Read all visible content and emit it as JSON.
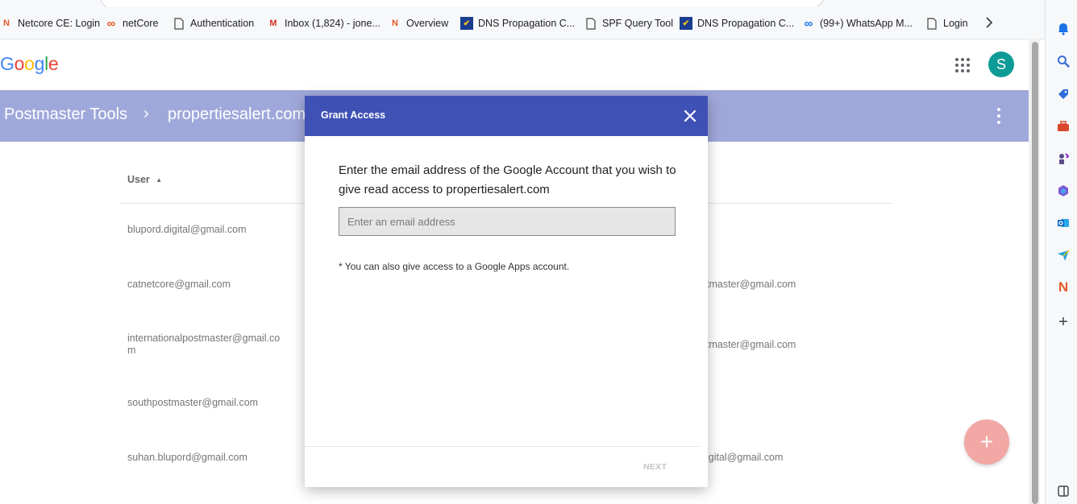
{
  "colors": {
    "header_band": "#9fa8da",
    "dialog_header": "#3f51b5",
    "avatar_bg": "#0e9b96",
    "fab_bg": "#f2a8a4"
  },
  "bookmarks": [
    {
      "label": "Netcore CE: Login",
      "icon": "netcore-n-icon"
    },
    {
      "label": "netCore",
      "icon": "infinity-icon"
    },
    {
      "label": "Authentication",
      "icon": "page-icon"
    },
    {
      "label": "Inbox (1,824) - jone...",
      "icon": "gmail-icon"
    },
    {
      "label": "Overview",
      "icon": "netcore-n-icon"
    },
    {
      "label": "DNS Propagation C...",
      "icon": "dns-check-icon"
    },
    {
      "label": "SPF Query Tool",
      "icon": "page-icon"
    },
    {
      "label": "DNS Propagation C...",
      "icon": "dns-check-icon"
    },
    {
      "label": "(99+) WhatsApp M...",
      "icon": "meta-icon"
    },
    {
      "label": "Login",
      "icon": "page-icon"
    }
  ],
  "google_logo": [
    "G",
    "o",
    "o",
    "g",
    "l",
    "e"
  ],
  "account": {
    "initial": "S"
  },
  "breadcrumb": {
    "root": "Postmaster Tools",
    "separator": "›",
    "domain": "propertiesalert.com"
  },
  "table": {
    "user_header": "User",
    "sort_indicator": "▲",
    "rows": [
      {
        "user": "blupord.digital@gmail.com",
        "right": ""
      },
      {
        "user": "catnetcore@gmail.com",
        "right": "tmaster@gmail.com"
      },
      {
        "user": "internationalpostmaster@gmail.co\nm",
        "right": "tmaster@gmail.com"
      },
      {
        "user": "southpostmaster@gmail.com",
        "right": ""
      },
      {
        "user": "suhan.blupord@gmail.com",
        "right": "igital@gmail.com"
      }
    ]
  },
  "dialog": {
    "title": "Grant Access",
    "message": "Enter the email address of the Google Account that you wish to give read access to propertiesalert.com",
    "email_placeholder": "Enter an email address",
    "email_value": "",
    "note": "* You can also give access to a Google Apps account.",
    "next_label": "NEXT"
  },
  "fab": {
    "symbol": "+"
  },
  "side_panel_icons": [
    "bell-icon",
    "search-icon",
    "tag-icon",
    "briefcase-icon",
    "chess-icon",
    "office-icon",
    "outlook-icon",
    "send-icon",
    "netcore-n-icon",
    "plus-icon",
    "split-view-icon"
  ]
}
